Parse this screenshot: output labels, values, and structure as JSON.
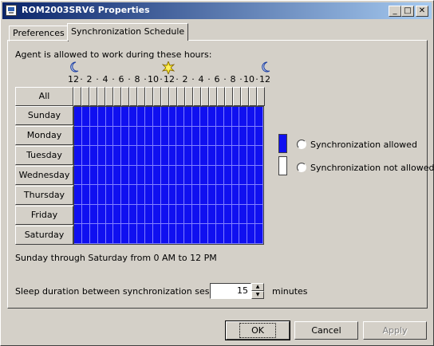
{
  "window": {
    "title": "ROM2003SRV6 Properties",
    "minimize": "_",
    "maximize": "□",
    "close": "✕"
  },
  "tabs": [
    {
      "label": "Preferences",
      "active": false
    },
    {
      "label": "Synchronization Schedule",
      "active": true
    }
  ],
  "schedule": {
    "heading": "Agent is allowed to work during these hours:",
    "hour_labels": [
      "12",
      "·",
      "2",
      "·",
      "4",
      "·",
      "6",
      "·",
      "8",
      "·",
      "10",
      "·",
      "12",
      "·",
      "2",
      "·",
      "4",
      "·",
      "6",
      "·",
      "8",
      "·",
      "10",
      "·",
      "12"
    ],
    "all_label": "All",
    "days": [
      "Sunday",
      "Monday",
      "Tuesday",
      "Wednesday",
      "Thursday",
      "Friday",
      "Saturday"
    ],
    "summary": "Sunday through Saturday from 0 AM to 12 PM",
    "colors": {
      "allowed": "#1010f0",
      "not_allowed": "#ffffff"
    },
    "icons": {
      "left": "moon-icon",
      "middle": "sun-icon",
      "right": "moon-icon"
    }
  },
  "legend": {
    "allowed_label": "Synchronization allowed",
    "not_allowed_label": "Synchronization not allowed"
  },
  "sleep": {
    "label": "Sleep duration between synchronization sessions:",
    "value": "15",
    "unit": "minutes"
  },
  "buttons": {
    "ok": "OK",
    "cancel": "Cancel",
    "apply": "Apply"
  }
}
